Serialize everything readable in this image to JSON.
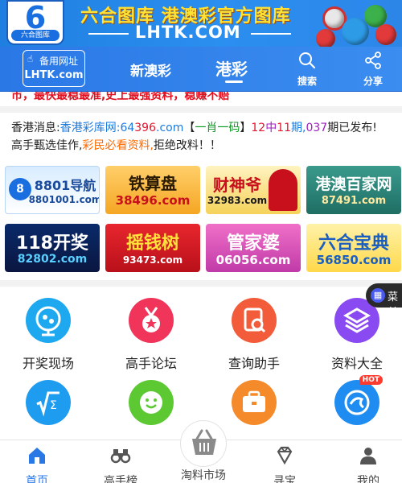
{
  "banner": {
    "logo_number": "6",
    "logo_label": "六合图库",
    "title": "六合图库 港澳彩官方图库",
    "url": "LHTK.COM"
  },
  "navbar": {
    "backup_label": "备用网址",
    "backup_url": "LHTK.com",
    "tabs": [
      {
        "label": "新澳彩",
        "active": false
      },
      {
        "label": "港彩",
        "active": true
      }
    ],
    "search_label": "搜索",
    "share_label": "分享"
  },
  "marquee": {
    "text": "市，最快最稳最准,史上最强资料，稳赚不赔"
  },
  "news": {
    "prefix": "香港消息:",
    "site_name": "香港彩库网:",
    "site_num_a": "64",
    "site_num_b": "396",
    "site_suffix": ".com",
    "open_bracket": "【",
    "bracket_text": "一肖一码",
    "close_bracket": "】",
    "count_a": "12",
    "count_mid": "中",
    "count_b": "11",
    "count_unit": "期,",
    "issue": "037",
    "issue_suffix": "期已发布!",
    "line2_a": "高手甄选佳作,",
    "line2_b": "彩民必看资料,",
    "line2_c": "拒绝改料！！"
  },
  "ads": [
    {
      "name": "8801导航",
      "sub": "8801001.com"
    },
    {
      "name": "铁算盘",
      "sub": "38496.com"
    },
    {
      "name": "财神爷",
      "sub": "32983.com"
    },
    {
      "name": "港澳百家网",
      "sub": "87491.com"
    },
    {
      "name": "118开奖",
      "sub": "82802.com"
    },
    {
      "name": "摇钱树",
      "sub": "93473.com"
    },
    {
      "name": "管家婆",
      "sub": "06056.com"
    },
    {
      "name": "六合宝典",
      "sub": "56850.com"
    }
  ],
  "float_menu": {
    "label": "菜单"
  },
  "features": [
    {
      "label": "开奖现场",
      "icon": "lottery-ball-icon",
      "color": "#1ea8f0"
    },
    {
      "label": "高手论坛",
      "icon": "medal-icon",
      "color": "#f0345a"
    },
    {
      "label": "查询助手",
      "icon": "search-doc-icon",
      "color": "#f25c3a"
    },
    {
      "label": "资料大全",
      "icon": "layers-icon",
      "color": "#8a4af2"
    },
    {
      "label": "",
      "icon": "formula-icon",
      "color": "#1e9cf0"
    },
    {
      "label": "",
      "icon": "smiley-icon",
      "color": "#5cc932"
    },
    {
      "label": "",
      "icon": "briefcase-icon",
      "color": "#f58a2a"
    },
    {
      "label": "",
      "icon": "zodiac-icon",
      "color": "#1e8cf0",
      "badge": "HOT"
    }
  ],
  "tabbar": {
    "tabs": [
      {
        "label": "首页",
        "active": true
      },
      {
        "label": "高手榜",
        "active": false
      },
      {
        "label": "寻宝",
        "active": false
      },
      {
        "label": "我的",
        "active": false
      }
    ],
    "center_label": "淘料市场"
  }
}
